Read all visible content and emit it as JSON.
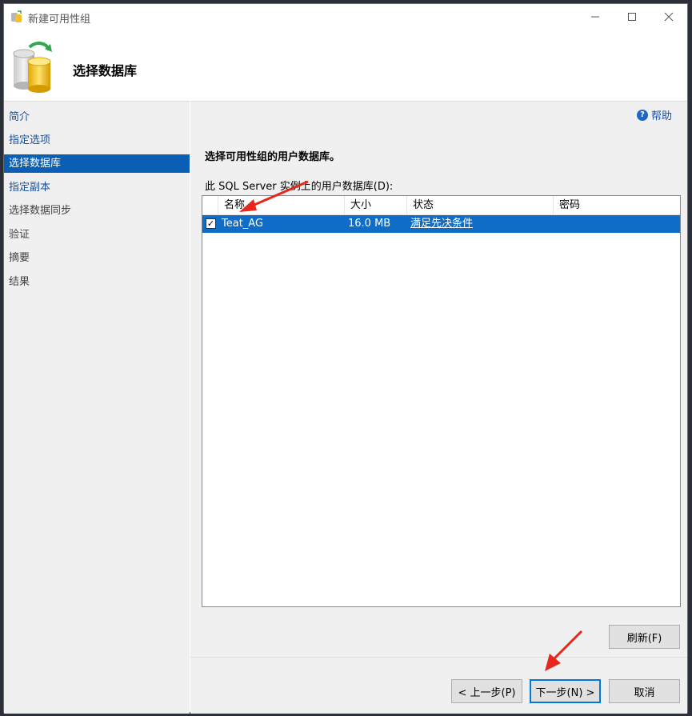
{
  "window": {
    "title": "新建可用性组",
    "header_title": "选择数据库"
  },
  "sidebar": {
    "items": [
      {
        "label": "简介"
      },
      {
        "label": "指定选项"
      },
      {
        "label": "选择数据库"
      },
      {
        "label": "指定副本"
      },
      {
        "label": "选择数据同步"
      },
      {
        "label": "验证"
      },
      {
        "label": "摘要"
      },
      {
        "label": "结果"
      }
    ]
  },
  "main": {
    "help_label": "帮助",
    "instruction": "选择可用性组的用户数据库。",
    "grid_label": "此 SQL Server 实例上的用户数据库(D):",
    "columns": [
      "名称",
      "大小",
      "状态",
      "密码"
    ],
    "rows": [
      {
        "checked": true,
        "name": "Teat_AG",
        "size": "16.0 MB",
        "status": "满足先决条件",
        "password": ""
      }
    ],
    "refresh_button": "刷新(F)"
  },
  "footer": {
    "back_button": "< 上一步(P)",
    "next_button": "下一步(N) >",
    "cancel_button": "取消"
  },
  "colors": {
    "selection": "#0f6dc8",
    "nav_selected": "#0a5fb4",
    "link": "#1a4f9c",
    "annotation_arrow": "#e8261b"
  },
  "icons": {
    "title": "database-app-icon",
    "header": "database-cylinder-icon",
    "help": "help-icon"
  }
}
